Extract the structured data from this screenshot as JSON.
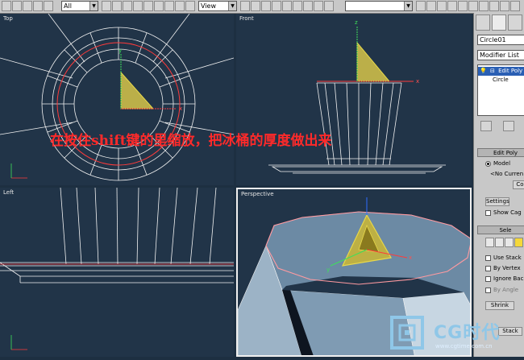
{
  "toolbar": {
    "filter_select": "All",
    "coord_select": "View",
    "named_sel": ""
  },
  "viewports": {
    "top": "Top",
    "front": "Front",
    "left": "Left",
    "perspective": "Perspective"
  },
  "axis_labels": {
    "x": "x",
    "y": "y",
    "z": "z"
  },
  "command_panel": {
    "object_name": "Circle01",
    "modifier_list": "Modifier List",
    "stack_items": [
      "Edit Poly",
      "Circle"
    ],
    "edit_poly_rollout": "Edit Poly",
    "mode_model": "Model",
    "no_current": "<No Curren",
    "settings_button": "Settings",
    "show_cage": "Show Cag",
    "selection_rollout": "Sele",
    "use_stack": "Use Stack",
    "by_vertex": "By Vertex",
    "ignore_back": "Ignore Bac",
    "by_angle": "By Angle",
    "shrink_button": "Shrink",
    "stack_button": "Stack",
    "commit_button": "Co"
  },
  "overlay_text": "在按住shift键的里缩放，把冰桶的厚度做出来",
  "watermark": {
    "brand": "CG时代",
    "site": "www.cgtime.com.cn"
  },
  "colors": {
    "viewport_bg": "#213448",
    "wire": "#f2f2f2",
    "selected": "#ff3b3b",
    "gizmo": "#e8d84a",
    "overlay": "#ff2a2a"
  }
}
